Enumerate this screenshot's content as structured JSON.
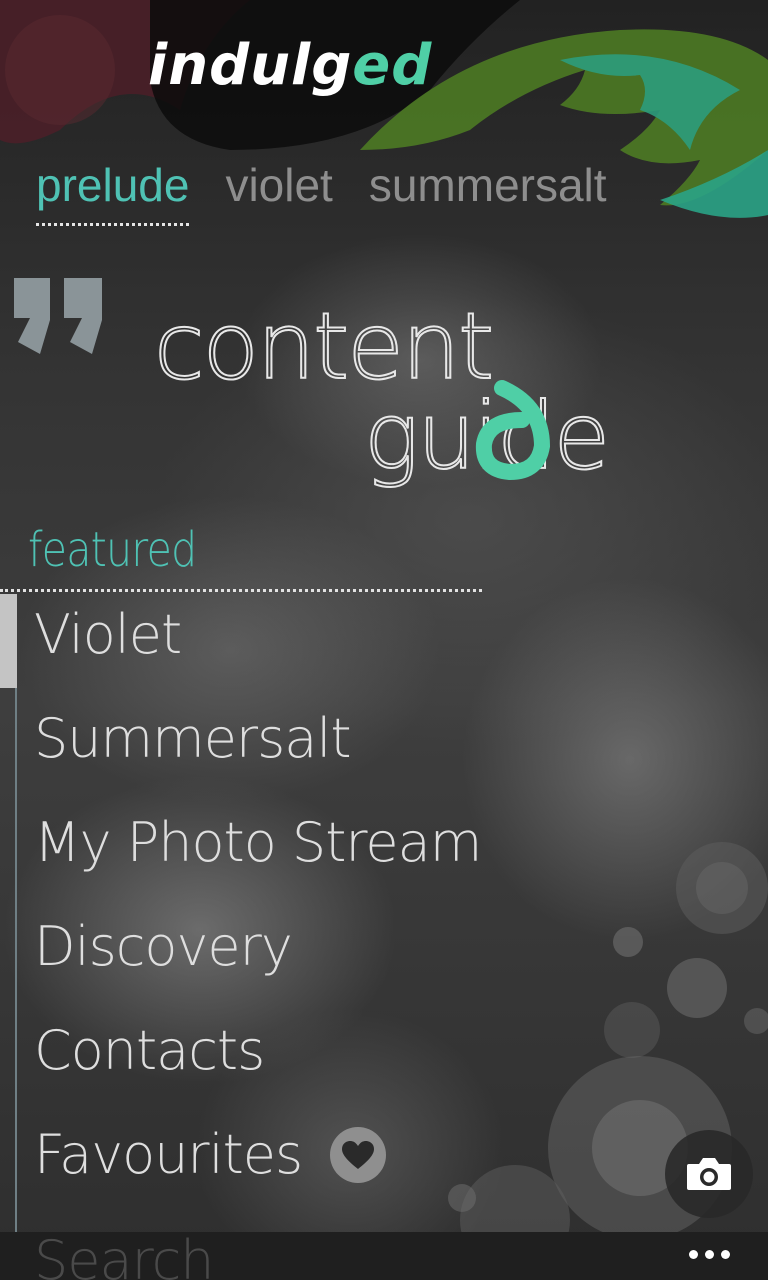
{
  "app": {
    "logo_main": "indulg",
    "logo_accent": "ed",
    "accent_color": "#4fc2b4"
  },
  "pivot": {
    "items": [
      {
        "label": "prelude",
        "active": true
      },
      {
        "label": "violet",
        "active": false
      },
      {
        "label": "summersalt",
        "active": false
      }
    ]
  },
  "hero": {
    "title_line1": "content",
    "title_line2": "guide"
  },
  "featured": {
    "header": "featured",
    "items": [
      {
        "label": "Violet"
      },
      {
        "label": "Summersalt"
      },
      {
        "label": "My Photo Stream"
      },
      {
        "label": "Discovery"
      },
      {
        "label": "Contacts"
      },
      {
        "label": "Favourites",
        "icon": "heart-icon"
      },
      {
        "label": "Search"
      }
    ]
  },
  "icons": {
    "camera": "camera-icon",
    "more": "more-icon"
  }
}
